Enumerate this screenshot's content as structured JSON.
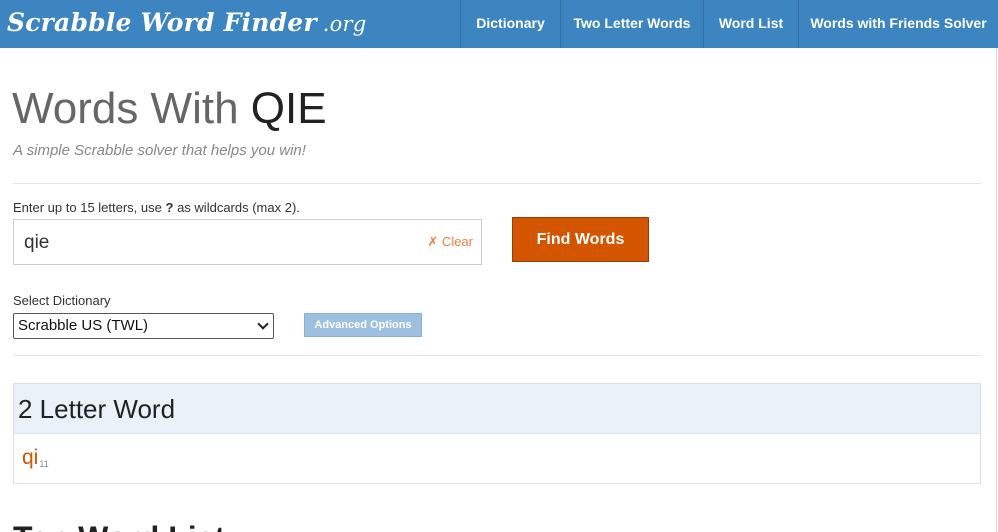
{
  "header": {
    "logo_main": "Scrabble Word Finder",
    "logo_suffix": ".org",
    "nav": [
      "Dictionary",
      "Two Letter Words",
      "Word List",
      "Words with Friends Solver"
    ]
  },
  "page": {
    "title_prefix": "Words With",
    "title_letters": "QIE",
    "tagline": "A simple Scrabble solver that helps you win!"
  },
  "search": {
    "hint_prefix": "Enter up to 15 letters, use",
    "hint_wild": "?",
    "hint_suffix": "as wildcards (max 2).",
    "value": "qie",
    "clear_label": "✗ Clear",
    "find_label": "Find Words"
  },
  "dictionary": {
    "label": "Select Dictionary",
    "selected": "Scrabble US (TWL)",
    "advanced_label": "Advanced Options"
  },
  "results": [
    {
      "heading": "2 Letter Word",
      "words": [
        {
          "word": "qi",
          "score": "11"
        }
      ]
    }
  ],
  "next_section_heading": "Top Word List"
}
